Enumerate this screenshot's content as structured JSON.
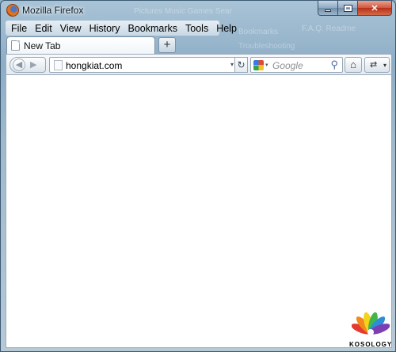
{
  "window": {
    "title": "Mozilla Firefox",
    "caption_buttons": {
      "minimize_icon": "minimize-icon",
      "maximize_icon": "maximize-icon",
      "close_icon": "close-icon",
      "close_glyph": "✕"
    }
  },
  "menubar": {
    "items": [
      {
        "label": "File"
      },
      {
        "label": "Edit"
      },
      {
        "label": "View"
      },
      {
        "label": "History"
      },
      {
        "label": "Bookmarks"
      },
      {
        "label": "Tools"
      },
      {
        "label": "Help"
      }
    ]
  },
  "tabs": [
    {
      "label": "New Tab",
      "icon": "page-icon"
    }
  ],
  "new_tab_button": {
    "label": "+"
  },
  "navbar": {
    "back_glyph": "◀",
    "forward_glyph": "▶",
    "url": "hongkiat.com",
    "url_dropdown_glyph": "▾",
    "reload_glyph": "↻",
    "search": {
      "engine_icon": "google-icon",
      "placeholder": "Google",
      "dropdown_glyph": "▾",
      "search_glyph": "⚲"
    },
    "home_glyph": "⌂",
    "sync_glyph": "⇄",
    "sync_dropdown_glyph": "▾"
  },
  "background_glass_text": [
    "Pictures   Music   Games   Sear",
    "Bookmarks",
    "F.A.Q. Readme",
    "Troubleshooting"
  ],
  "watermark": {
    "text": "KOSOLOGY"
  },
  "colors": {
    "close_button": "#c4412a",
    "frame": "#9fb9cc",
    "content_bg": "#ffffff"
  }
}
